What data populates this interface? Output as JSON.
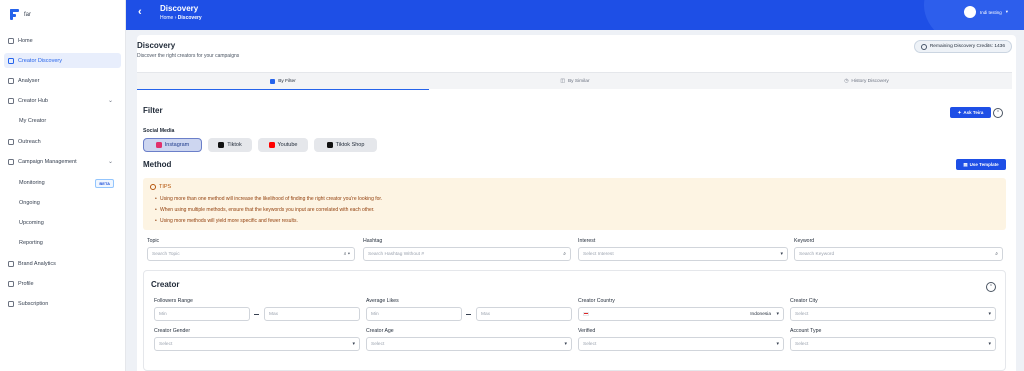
{
  "app": {
    "logo_text": "far"
  },
  "sidebar": {
    "items": [
      {
        "label": "Home"
      },
      {
        "label": "Creator Discovery"
      },
      {
        "label": "Analyser"
      },
      {
        "label": "Creator Hub"
      },
      {
        "label": "My Creator"
      },
      {
        "label": "Outreach"
      },
      {
        "label": "Campaign Management"
      },
      {
        "label": "Monitoring",
        "badge": "BETA"
      },
      {
        "label": "Ongoing"
      },
      {
        "label": "Upcoming"
      },
      {
        "label": "Reporting"
      },
      {
        "label": "Brand Analytics"
      },
      {
        "label": "Profile"
      },
      {
        "label": "Subscription"
      }
    ]
  },
  "header": {
    "title": "Discovery",
    "breadcrumb_home": "Home",
    "breadcrumb_sep": "›",
    "breadcrumb_current": "Discovery",
    "user_name": "Indi testing",
    "user_caret": "▾"
  },
  "page": {
    "title": "Discovery",
    "subtitle": "Discover the right creators for your campaigns",
    "credits": "Remaining Discovery Credits: 1436"
  },
  "tabs": [
    {
      "label": "By Filter"
    },
    {
      "label": "By Similar"
    },
    {
      "label": "History Discovery"
    }
  ],
  "filter": {
    "title": "Filter",
    "ask_button": "Ask Teira",
    "social_media_label": "Social Media",
    "social_media": [
      {
        "label": "Instagram",
        "color": "#e1306c"
      },
      {
        "label": "Tiktok",
        "color": "#111111"
      },
      {
        "label": "Youtube",
        "color": "#ff0000"
      },
      {
        "label": "Tiktok Shop",
        "color": "#111111"
      }
    ]
  },
  "method": {
    "title": "Method",
    "template_button": "Use Template",
    "tips_title": "TIPS",
    "tips": [
      "Using more than one method will increase the likelihood of finding the right creator you're looking for.",
      "When using multiple methods, ensure that the keywords you input are correlated with each other.",
      "Using more methods will yield more specific and fewer results."
    ],
    "fields": [
      {
        "label": "Topic",
        "placeholder": "Search Topic"
      },
      {
        "label": "Hashtag",
        "placeholder": "Search Hashtag Without #"
      },
      {
        "label": "Interest",
        "placeholder": "Select Interest"
      },
      {
        "label": "Keyword",
        "placeholder": "Search Keyword"
      }
    ]
  },
  "creator": {
    "title": "Creator",
    "followers_label": "Followers Range",
    "likes_label": "Average Likes",
    "country_label": "Creator Country",
    "city_label": "Creator City",
    "min": "Min",
    "max": "Max",
    "country_value": "Indonesia",
    "select": "Select",
    "gender_label": "Creator Gender",
    "age_label": "Creator Age",
    "verified_label": "Verified",
    "account_type_label": "Account Type"
  }
}
